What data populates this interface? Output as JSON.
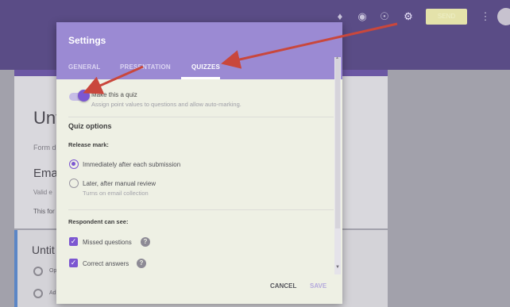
{
  "background_form": {
    "title": "Unt",
    "description": "Form d",
    "email_label": "Emai",
    "email_validation": "Valid e",
    "email_note": "This for",
    "question_title": "Untit",
    "options": [
      "Op",
      "Ad"
    ]
  },
  "toolbar": {
    "send_label": "SEND"
  },
  "dialog": {
    "title": "Settings",
    "tabs": [
      {
        "label": "GENERAL",
        "active": false
      },
      {
        "label": "PRESENTATION",
        "active": false
      },
      {
        "label": "QUIZZES",
        "active": true
      }
    ],
    "make_quiz": {
      "label": "Make this a quiz",
      "description": "Assign point values to questions and allow auto-marking.",
      "enabled": true
    },
    "quiz_options_heading": "Quiz options",
    "release_mark": {
      "heading": "Release mark:",
      "options": [
        {
          "label": "Immediately after each submission",
          "selected": true,
          "sub": ""
        },
        {
          "label": "Later, after manual review",
          "selected": false,
          "sub": "Turns on email collection"
        }
      ]
    },
    "respondent": {
      "heading": "Respondent can see:",
      "items": [
        {
          "label": "Missed questions",
          "checked": true
        },
        {
          "label": "Correct answers",
          "checked": true
        }
      ]
    },
    "cancel_label": "CANCEL",
    "save_label": "SAVE"
  },
  "colors": {
    "accent": "#7c57d1",
    "header": "#9b8ad3",
    "arrow": "#c9473c"
  },
  "icons": [
    "puzzle-icon",
    "palette-icon",
    "eye-icon",
    "gear-icon",
    "more-vert-icon",
    "help-icon",
    "check-icon"
  ]
}
